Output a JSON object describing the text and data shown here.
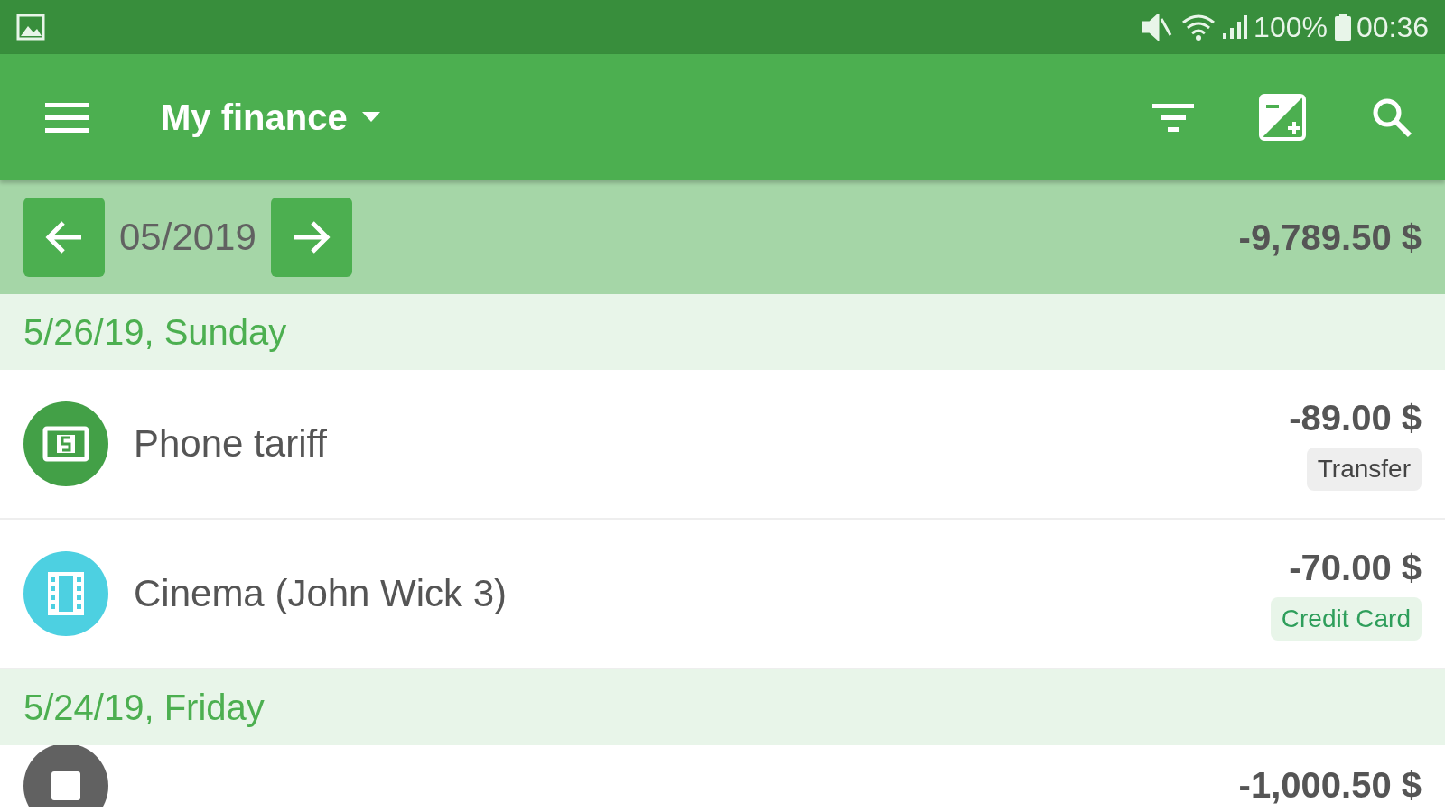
{
  "status_bar": {
    "battery": "100%",
    "time": "00:36"
  },
  "toolbar": {
    "title": "My finance"
  },
  "period": {
    "label": "05/2019",
    "total": "-9,789.50 $"
  },
  "days": [
    {
      "date": "5/26/19, Sunday",
      "transactions": [
        {
          "name": "Phone tariff",
          "amount": "-89.00 $",
          "kind": "cash",
          "color": "#43a047",
          "account": {
            "label": "Transfer",
            "kind": "neutral"
          }
        },
        {
          "name": "Cinema (John Wick 3)",
          "amount": "-70.00 $",
          "kind": "film",
          "color": "#4dd0e1",
          "account": {
            "label": "Credit Card",
            "kind": "card"
          }
        }
      ]
    },
    {
      "date": "5/24/19, Friday",
      "transactions": [
        {
          "amount": "-1,000.50 $",
          "kind": "other",
          "color": "#616161"
        }
      ]
    }
  ]
}
